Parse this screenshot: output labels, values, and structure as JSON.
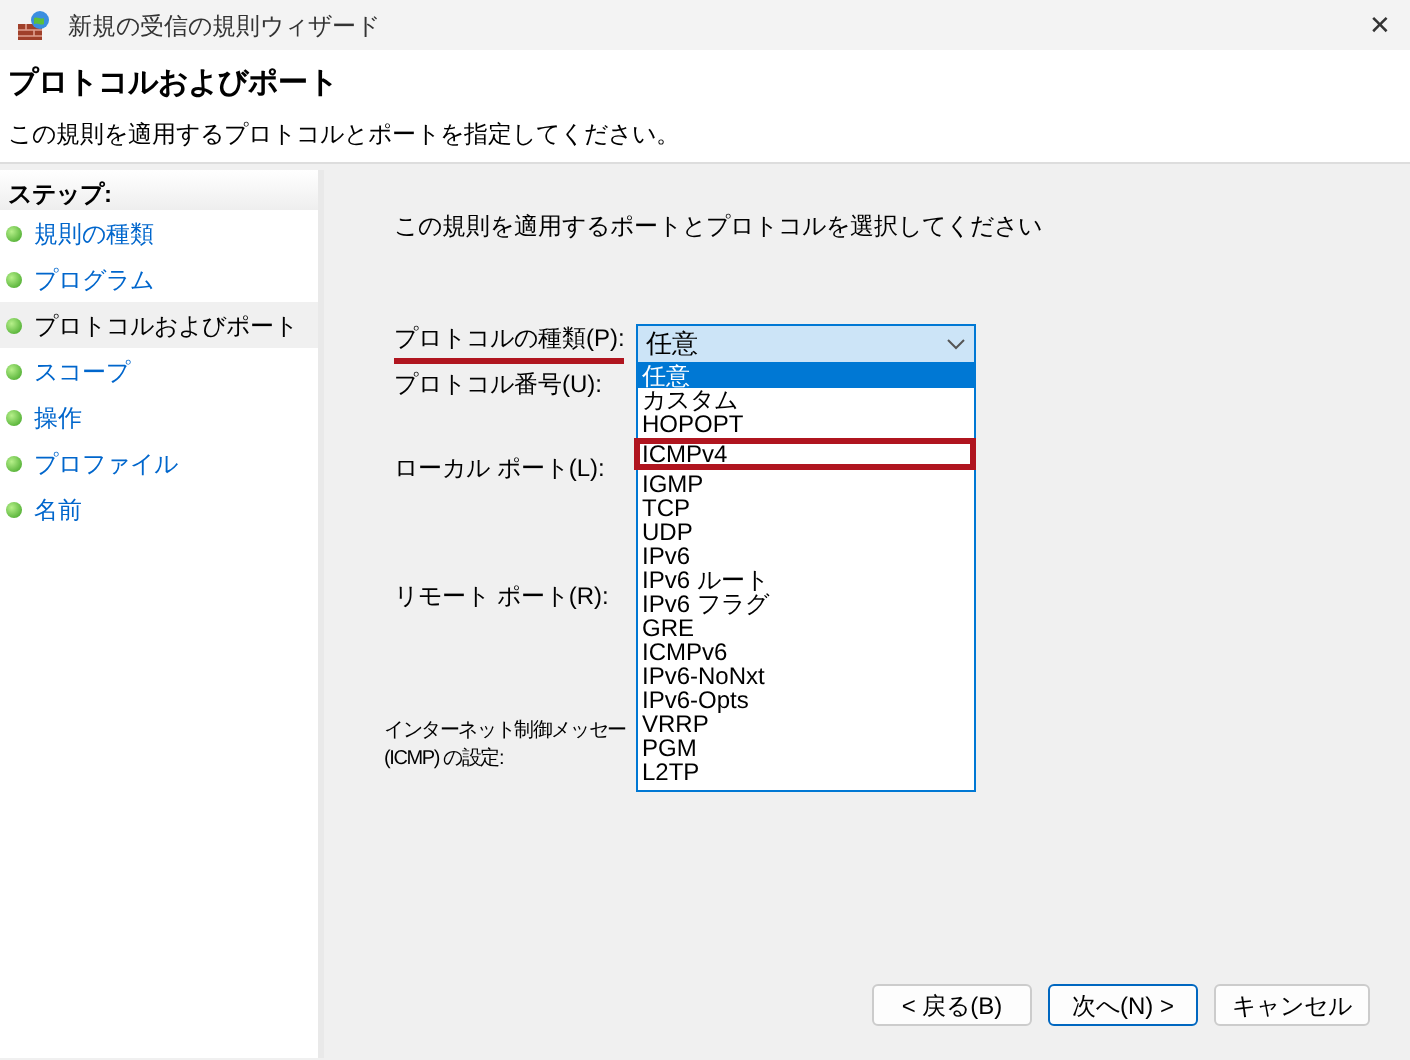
{
  "window": {
    "title": "新規の受信の規則ウィザード",
    "close": "✕"
  },
  "header": {
    "title": "プロトコルおよびポート",
    "subtitle": "この規則を適用するプロトコルとポートを指定してください。"
  },
  "steps": {
    "heading": "ステップ:",
    "items": [
      {
        "label": "規則の種類",
        "selected": false
      },
      {
        "label": "プログラム",
        "selected": false
      },
      {
        "label": "プロトコルおよびポート",
        "selected": true
      },
      {
        "label": "スコープ",
        "selected": false
      },
      {
        "label": "操作",
        "selected": false
      },
      {
        "label": "プロファイル",
        "selected": false
      },
      {
        "label": "名前",
        "selected": false
      }
    ]
  },
  "instruction": "この規則を適用するポートとプロトコルを選択してください",
  "form": {
    "protocol_type_label": "プロトコルの種類(P):",
    "protocol_type_annotated": true,
    "protocol_number_label": "プロトコル番号(U):",
    "local_port_label": "ローカル ポート(L):",
    "remote_port_label": "リモート ポート(R):",
    "icmp_label_lines": [
      "インターネット制御メッセー",
      "(ICMP) の設定:"
    ]
  },
  "protocol_combo": {
    "value": "任意",
    "options": [
      {
        "label": "任意",
        "selected": true,
        "annotated": false
      },
      {
        "label": "カスタム",
        "selected": false,
        "annotated": false
      },
      {
        "label": "HOPOPT",
        "selected": false,
        "annotated": false
      },
      {
        "label": "ICMPv4",
        "selected": false,
        "annotated": true
      },
      {
        "label": "IGMP",
        "selected": false,
        "annotated": false
      },
      {
        "label": "TCP",
        "selected": false,
        "annotated": false
      },
      {
        "label": "UDP",
        "selected": false,
        "annotated": false
      },
      {
        "label": "IPv6",
        "selected": false,
        "annotated": false
      },
      {
        "label": "IPv6 ルート",
        "selected": false,
        "annotated": false
      },
      {
        "label": "IPv6 フラグ",
        "selected": false,
        "annotated": false
      },
      {
        "label": "GRE",
        "selected": false,
        "annotated": false
      },
      {
        "label": "ICMPv6",
        "selected": false,
        "annotated": false
      },
      {
        "label": "IPv6-NoNxt",
        "selected": false,
        "annotated": false
      },
      {
        "label": "IPv6-Opts",
        "selected": false,
        "annotated": false
      },
      {
        "label": "VRRP",
        "selected": false,
        "annotated": false
      },
      {
        "label": "PGM",
        "selected": false,
        "annotated": false
      },
      {
        "label": "L2TP",
        "selected": false,
        "annotated": false
      }
    ]
  },
  "buttons": [
    {
      "label": "< 戻る(B)",
      "default": false
    },
    {
      "label": "次へ(N) >",
      "default": true
    },
    {
      "label": "キャンセル",
      "default": false
    }
  ]
}
